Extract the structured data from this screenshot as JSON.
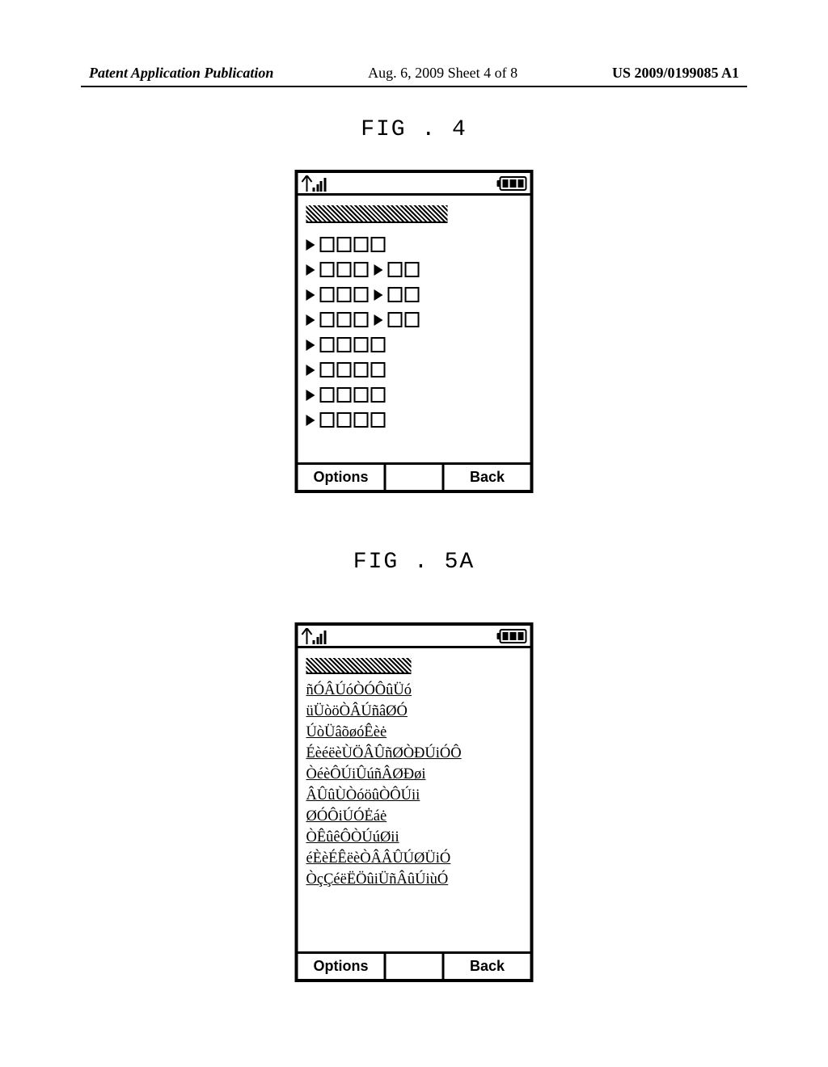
{
  "header": {
    "left": "Patent Application Publication",
    "center": "Aug. 6, 2009  Sheet 4 of 8",
    "right": "US 2009/0199085 A1"
  },
  "figures": {
    "fig4": {
      "label": "FIG . 4"
    },
    "fig5a": {
      "label": "FIG . 5A"
    }
  },
  "softkeys": {
    "options": "Options",
    "back": "Back"
  },
  "phone2_items": [
    "ñÓÂÚóÒÓÔûÜó",
    "üÜòöÒÂÚñâØÓ",
    "ÚòÜâõøóÊèė",
    "ÉèéëèÙÖÂÛñØÒÐÚiÓÔ",
    "ÒéèÔÚiÛúñÂØÐøi",
    "ÂÛûÙÒóöûÒÔÚii",
    "ØÓÔiÚÓĖáė",
    "ÒÊûêÔÒÚúØii",
    "éÈèÉÊëèÒÂÂÛÚØÜiÓ",
    "ÒçÇéëËÖûiÜñÂûÚiùÓ"
  ]
}
